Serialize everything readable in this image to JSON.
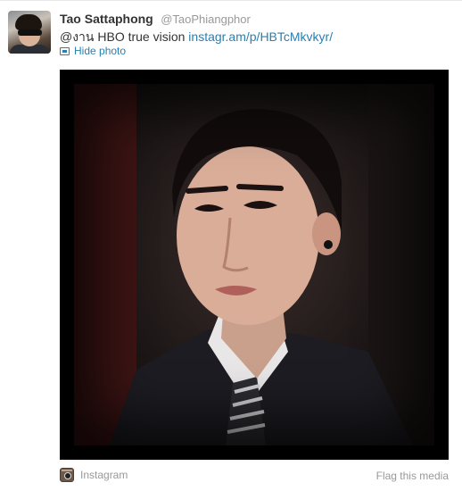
{
  "tweet": {
    "full_name": "Tao Sattaphong",
    "username": "@TaoPhiangphor",
    "text_prefix": "@งาน HBO true vision",
    "link_text": "instagr.am/p/HBTcMkvkyr/",
    "hide_photo_label": "Hide photo"
  },
  "media": {
    "provider": "Instagram",
    "flag_label": "Flag this media",
    "photo_description_icon": "portrait-photo"
  },
  "colors": {
    "link": "#2a7fb0",
    "muted": "#999999",
    "text": "#333333"
  }
}
